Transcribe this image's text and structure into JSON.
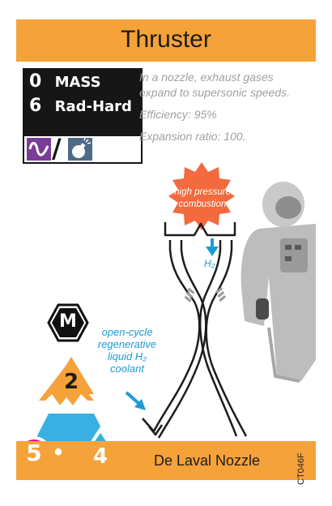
{
  "card": {
    "title": "Thruster",
    "stats": [
      {
        "value": "0",
        "label": "MASS"
      },
      {
        "value": "6",
        "label": "Rad-Hard"
      }
    ],
    "type_icons": [
      "wave-icon",
      "bomb-icon"
    ],
    "type_separator": "/",
    "description": [
      "In a nozzle, exhaust gases",
      "expand to supersonic speeds.",
      "Efficiency: 95%",
      "Expansion ratio: 100."
    ],
    "illustration": {
      "burst_label": [
        "high pressure",
        "combustion"
      ],
      "flow_label": "H₂",
      "coolant_label": [
        "open-cycle",
        "regenerative",
        "liquid H₂",
        "coolant"
      ]
    },
    "faction_letter": "M",
    "cost": {
      "top_number": "2",
      "left_number": "5",
      "right_number": "4",
      "separator": "•"
    },
    "name": "De Laval Nozzle",
    "code": "CT046F",
    "colors": {
      "bar": "#f5a23a",
      "stat_box": "#161616",
      "wave_icon": "#7a3d97",
      "bomb_icon": "#4f6a86",
      "burst": "#f26a3d",
      "label_blue": "#1d9ad6",
      "cost_blue": "#39b0e1",
      "cost_magenta": "#e7007c"
    }
  }
}
